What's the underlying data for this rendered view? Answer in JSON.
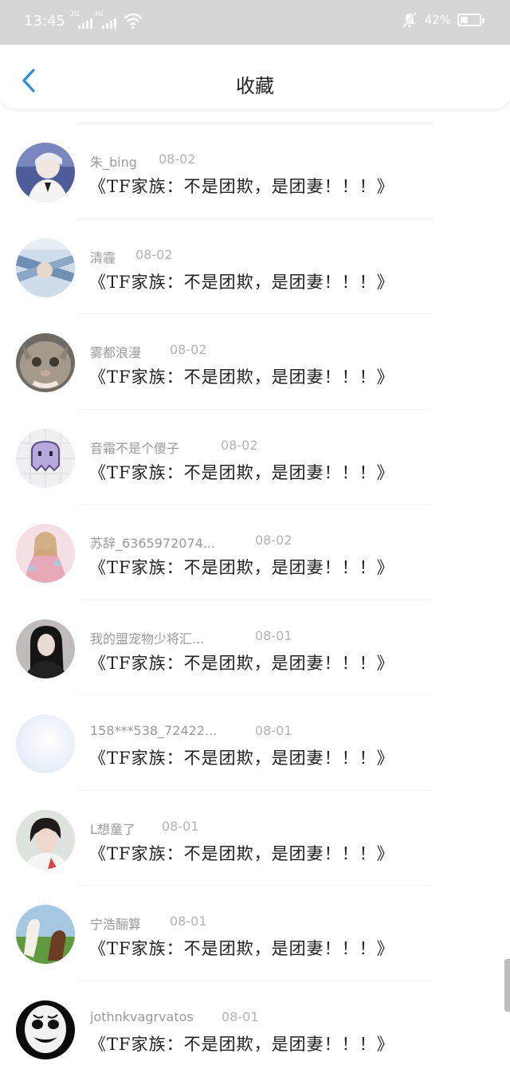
{
  "status_bar": {
    "time": "13:45",
    "signal_1_tag": "2G",
    "signal_2_tag": "4G",
    "battery_percent": "42%",
    "battery_level": 0.42
  },
  "header": {
    "title": "收藏"
  },
  "favorites": [
    {
      "username": "朱_bing",
      "date": "08-02",
      "title": "《TF家族：不是团欺，是团妻！！！》"
    },
    {
      "username": "清霾",
      "date": "08-02",
      "title": "《TF家族：不是团欺，是团妻！！！》"
    },
    {
      "username": "雾都浪漫",
      "date": "08-02",
      "title": "《TF家族：不是团欺，是团妻！！！》"
    },
    {
      "username": "音霜不是个傻子",
      "date": "08-02",
      "title": "《TF家族：不是团欺，是团妻！！！》"
    },
    {
      "username": "苏辞_6365972074...",
      "date": "08-02",
      "title": "《TF家族：不是团欺，是团妻！！！》"
    },
    {
      "username": "我的盟宠物少将汇...",
      "date": "08-01",
      "title": "《TF家族：不是团欺，是团妻！！！》"
    },
    {
      "username": "158***538_72422...",
      "date": "08-01",
      "title": "《TF家族：不是团欺，是团妻！！！》"
    },
    {
      "username": "L想童了",
      "date": "08-01",
      "title": "《TF家族：不是团欺，是团妻！！！》"
    },
    {
      "username": "宁浩酾算",
      "date": "08-01",
      "title": "《TF家族：不是团欺，是团妻！！！》"
    },
    {
      "username": "jothnkvagrvatos",
      "date": "08-01",
      "title": "《TF家族：不是团欺，是团妻！！！》"
    }
  ],
  "colors": {
    "accent": "#2f8fdf",
    "status_bar_bg": "#d6d6d6",
    "username": "#9a9a9a",
    "date": "#b3b3b3"
  }
}
